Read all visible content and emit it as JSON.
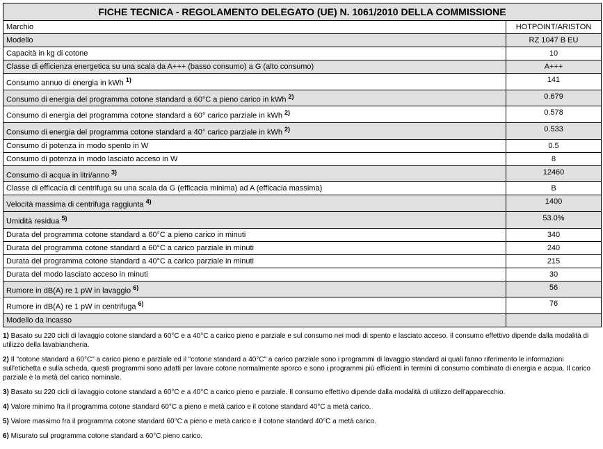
{
  "title": "FICHE TECNICA - REGOLAMENTO DELEGATO (UE) N. 1061/2010 DELLA COMMISSIONE",
  "rows": [
    {
      "label": "Marchio",
      "value": "HOTPOINT/ARISTON",
      "shade": false
    },
    {
      "label": "Modello",
      "value": "RZ 1047 B EU",
      "shade": true
    },
    {
      "label": "Capacità in kg di cotone",
      "value": "10",
      "shade": false
    },
    {
      "label": "Classe di efficienza energetica su una scala da A+++ (basso consumo) a G (alto consumo)",
      "value": "A+++",
      "shade": true
    },
    {
      "label": "Consumo annuo di energia in kWh ",
      "sup": "1)",
      "value": "141",
      "shade": false
    },
    {
      "label": "Consumo di energia del programma cotone standard a 60°C a pieno carico in kWh ",
      "sup": "2)",
      "value": "0.679",
      "shade": true
    },
    {
      "label": "Consumo di energia del programma cotone standard a 60° carico parziale in kWh ",
      "sup": "2)",
      "value": "0.578",
      "shade": false
    },
    {
      "label": "Consumo di energia del programma cotone standard a 40° carico parziale in kWh ",
      "sup": "2)",
      "value": "0.533",
      "shade": true
    },
    {
      "label": "Consumo di potenza in modo spento in W",
      "value": "0.5",
      "shade": false
    },
    {
      "label": "Consumo di potenza in modo lasciato acceso in W",
      "value": "8",
      "shade": false
    },
    {
      "label": "Consumo di acqua in litri/anno ",
      "sup": "3)",
      "value": "12460",
      "shade": true
    },
    {
      "label": "Classe di efficacia di centrifuga su una scala da G (efficacia minima) ad A (efficacia massima)",
      "value": "B",
      "shade": false
    },
    {
      "label": "Velocità massima di centrifuga raggiunta ",
      "sup": "4)",
      "value": "1400",
      "shade": true
    },
    {
      "label": "Umidità residua ",
      "sup": "5)",
      "value": "53.0%",
      "shade": true
    },
    {
      "label": "Durata del programma cotone standard a 60°C a pieno carico in minuti",
      "value": "340",
      "shade": false
    },
    {
      "label": "Durata del programma cotone standard a 60°C a carico parziale in minuti",
      "value": "240",
      "shade": false
    },
    {
      "label": "Durata del programma cotone standard a 40°C a carico parziale in minuti",
      "value": "215",
      "shade": false
    },
    {
      "label": "Durata del modo lasciato acceso in minuti",
      "value": "30",
      "shade": false
    },
    {
      "label": "Rumore in dB(A) re 1 pW in lavaggio ",
      "sup": "6)",
      "value": "56",
      "shade": true
    },
    {
      "label": "Rumore in dB(A) re 1 pW in centrifuga ",
      "sup": "6)",
      "value": "76",
      "shade": false
    },
    {
      "label": "Modello da incasso",
      "value": "",
      "shade": true
    }
  ],
  "footnotes": [
    {
      "n": "1)",
      "text": " Basato su 220 cicli di lavaggio cotone standard a 60°C e a 40°C a carico pieno e parziale e sul consumo nei modi di spento e lasciato acceso. Il consumo effettivo dipende dalla modalità di utilizzo della lavabiancheria."
    },
    {
      "n": "2)",
      "text": " Il \"cotone standard a 60°C\" a carico pieno e parziale ed il \"cotone standard a 40°C\" a carico parziale sono i programmi di lavaggio standard ai quali fanno riferimento le informazioni sull'etichetta e sulla scheda, questi programmi sono adatti per lavare cotone normalmente sporco e sono i programmi più efficienti in termini di consumo combinato di energia e acqua. Il carico parziale è la metà del carico nominale."
    },
    {
      "n": "3)",
      "text": " Basato su 220 cicli di lavaggio cotone standard a 60°C e a 40°C a carico pieno e parziale. Il consumo effettivo dipende dalla modalità di utilizzo dell'apparecchio."
    },
    {
      "n": "4)",
      "text": " Valore minimo fra il programma cotone standard 60°C a pieno e metà carico e il cotone standard 40°C a metà carico."
    },
    {
      "n": "5)",
      "text": " Valore massimo fra il programma cotone standard 60°C a pieno e metà carico e il cotone standard 40°C a metà carico."
    },
    {
      "n": "6)",
      "text": " Misurato sul programma cotone standard a 60°C pieno carico."
    }
  ]
}
